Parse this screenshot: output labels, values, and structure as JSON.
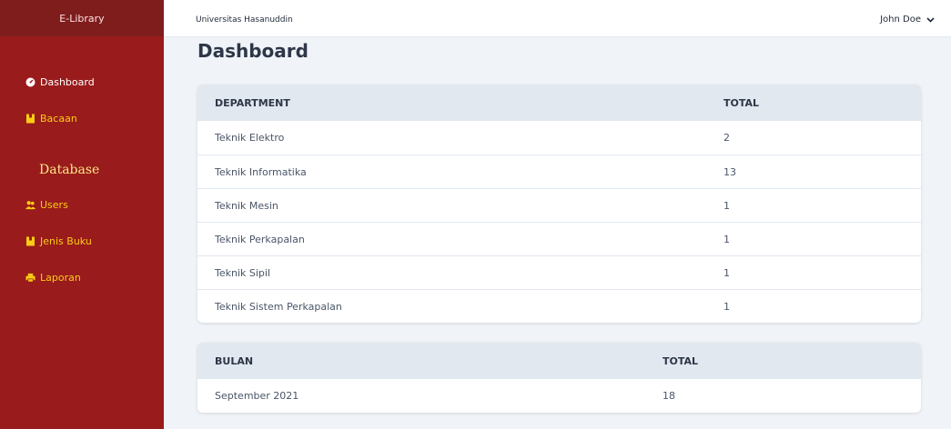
{
  "sidebar": {
    "brand": "E-Library",
    "items": [
      {
        "label": "Dashboard",
        "icon": "dashboard-gauge-icon"
      },
      {
        "label": "Bacaan",
        "icon": "book-icon"
      }
    ],
    "section_heading": "Database",
    "database_items": [
      {
        "label": "Users",
        "icon": "users-icon"
      },
      {
        "label": "Jenis Buku",
        "icon": "book-icon"
      },
      {
        "label": "Laporan",
        "icon": "print-icon"
      }
    ],
    "colors": {
      "background": "#991b1b",
      "accent": "#facc15"
    }
  },
  "topbar": {
    "org_name": "Universitas Hasanuddin",
    "user_name": "John Doe"
  },
  "main": {
    "title": "Dashboard",
    "department_table": {
      "headers": [
        "DEPARTMENT",
        "TOTAL"
      ],
      "rows": [
        {
          "name": "Teknik Elektro",
          "total": "2"
        },
        {
          "name": "Teknik Informatika",
          "total": "13"
        },
        {
          "name": "Teknik Mesin",
          "total": "1"
        },
        {
          "name": "Teknik Perkapalan",
          "total": "1"
        },
        {
          "name": "Teknik Sipil",
          "total": "1"
        },
        {
          "name": "Teknik Sistem Perkapalan",
          "total": "1"
        }
      ]
    },
    "month_table": {
      "headers": [
        "BULAN",
        "TOTAL"
      ],
      "rows": [
        {
          "name": "September 2021",
          "total": "18"
        }
      ]
    }
  }
}
